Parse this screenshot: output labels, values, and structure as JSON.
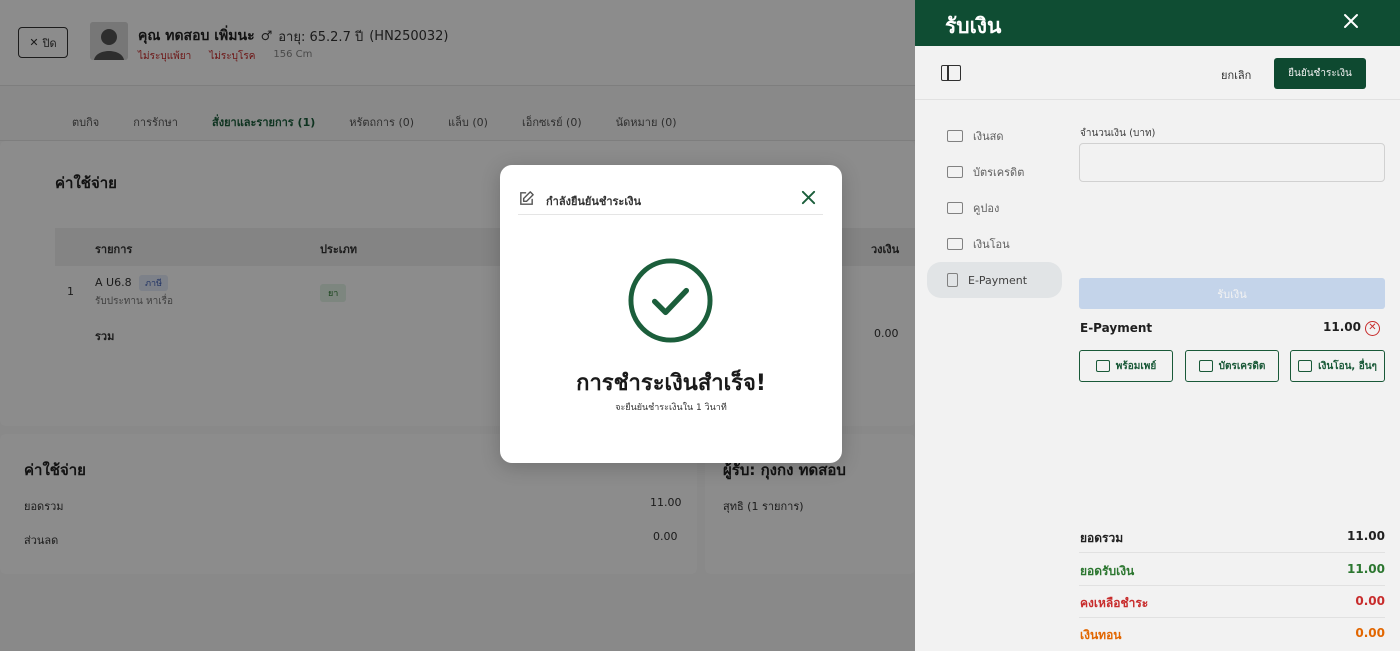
{
  "background": {
    "close_label": "ปิด",
    "patient": {
      "name": "คุณ ทดสอบ เพิ่มนะ",
      "gender_symbol": "♂",
      "age": "อายุ: 65.2.7 ปี",
      "hn": "(HN250032)",
      "allergy": "ไม่ระบุแพ้ยา",
      "disease": "ไม่ระบุโรค",
      "height": "156 Cm"
    },
    "tabs": [
      {
        "label": "ตบกิจ"
      },
      {
        "label": "การรักษา"
      },
      {
        "label": "สั่งยาและรายการ (1)"
      },
      {
        "label": "หรัตถการ (0)"
      },
      {
        "label": "แล็บ (0)"
      },
      {
        "label": "เอ็กซเรย์ (0)"
      },
      {
        "label": "นัดหมาย (0)"
      }
    ],
    "expense_title": "ค่าใช้จ่าย",
    "table": {
      "col_item": "รายการ",
      "col_type": "ประเภท",
      "col_amount": "วงเงิน",
      "row_index": "1",
      "row_name": "A U6.8",
      "row_tag": "ภาษี",
      "row_desc": "รับประทาน หาเรื่อ",
      "row_type_tag": "ยา",
      "total_label": "รวม",
      "total_value": "0.00"
    },
    "summary": {
      "title": "ค่าใช้จ่าย",
      "subtotal_label": "ยอดรวม",
      "subtotal_value": "11.00",
      "discount_label": "ส่วนลด",
      "discount_value": "0.00"
    },
    "right_card": {
      "title": "ผู้รับ: กุงกง ทดสอบ",
      "line": "สุทธิ (1 รายการ)"
    }
  },
  "drawer": {
    "title": "รับเงิน",
    "cancel_label": "ยกเลิก",
    "confirm_label": "ยืนยันชำระเงิน",
    "methods": [
      {
        "label": "เงินสด"
      },
      {
        "label": "บัตรเครดิต"
      },
      {
        "label": "คูปอง"
      },
      {
        "label": "เงินโอน"
      },
      {
        "label": "E-Payment"
      }
    ],
    "amount_label": "จำนวนเงิน (บาท)",
    "amount_value": "",
    "receive_label": "รับเงิน",
    "epay_label": "E-Payment",
    "epay_amount": "11.00",
    "pay_buttons": [
      {
        "label": "พร้อมเพย์"
      },
      {
        "label": "บัตรเครดิต"
      },
      {
        "label": "เงินโอน, อื่นๆ"
      }
    ],
    "totals": [
      {
        "label": "ยอดรวม",
        "value": "11.00",
        "color": "#222222"
      },
      {
        "label": "ยอดรับเงิน",
        "value": "11.00",
        "color": "#2e7d32"
      },
      {
        "label": "คงเหลือชำระ",
        "value": "0.00",
        "color": "#d32f2f"
      },
      {
        "label": "เงินทอน",
        "value": "0.00",
        "color": "#ef6c00"
      }
    ]
  },
  "modal": {
    "title": "กำลังยืนยันชำระเงิน",
    "success_title": "การชำระเงินสำเร็จ!",
    "success_sub": "จะยืนยันชำระเงินใน 1 วินาที"
  },
  "colors": {
    "brand": "#0f4d33",
    "success_ring": "#1b5e3b"
  }
}
